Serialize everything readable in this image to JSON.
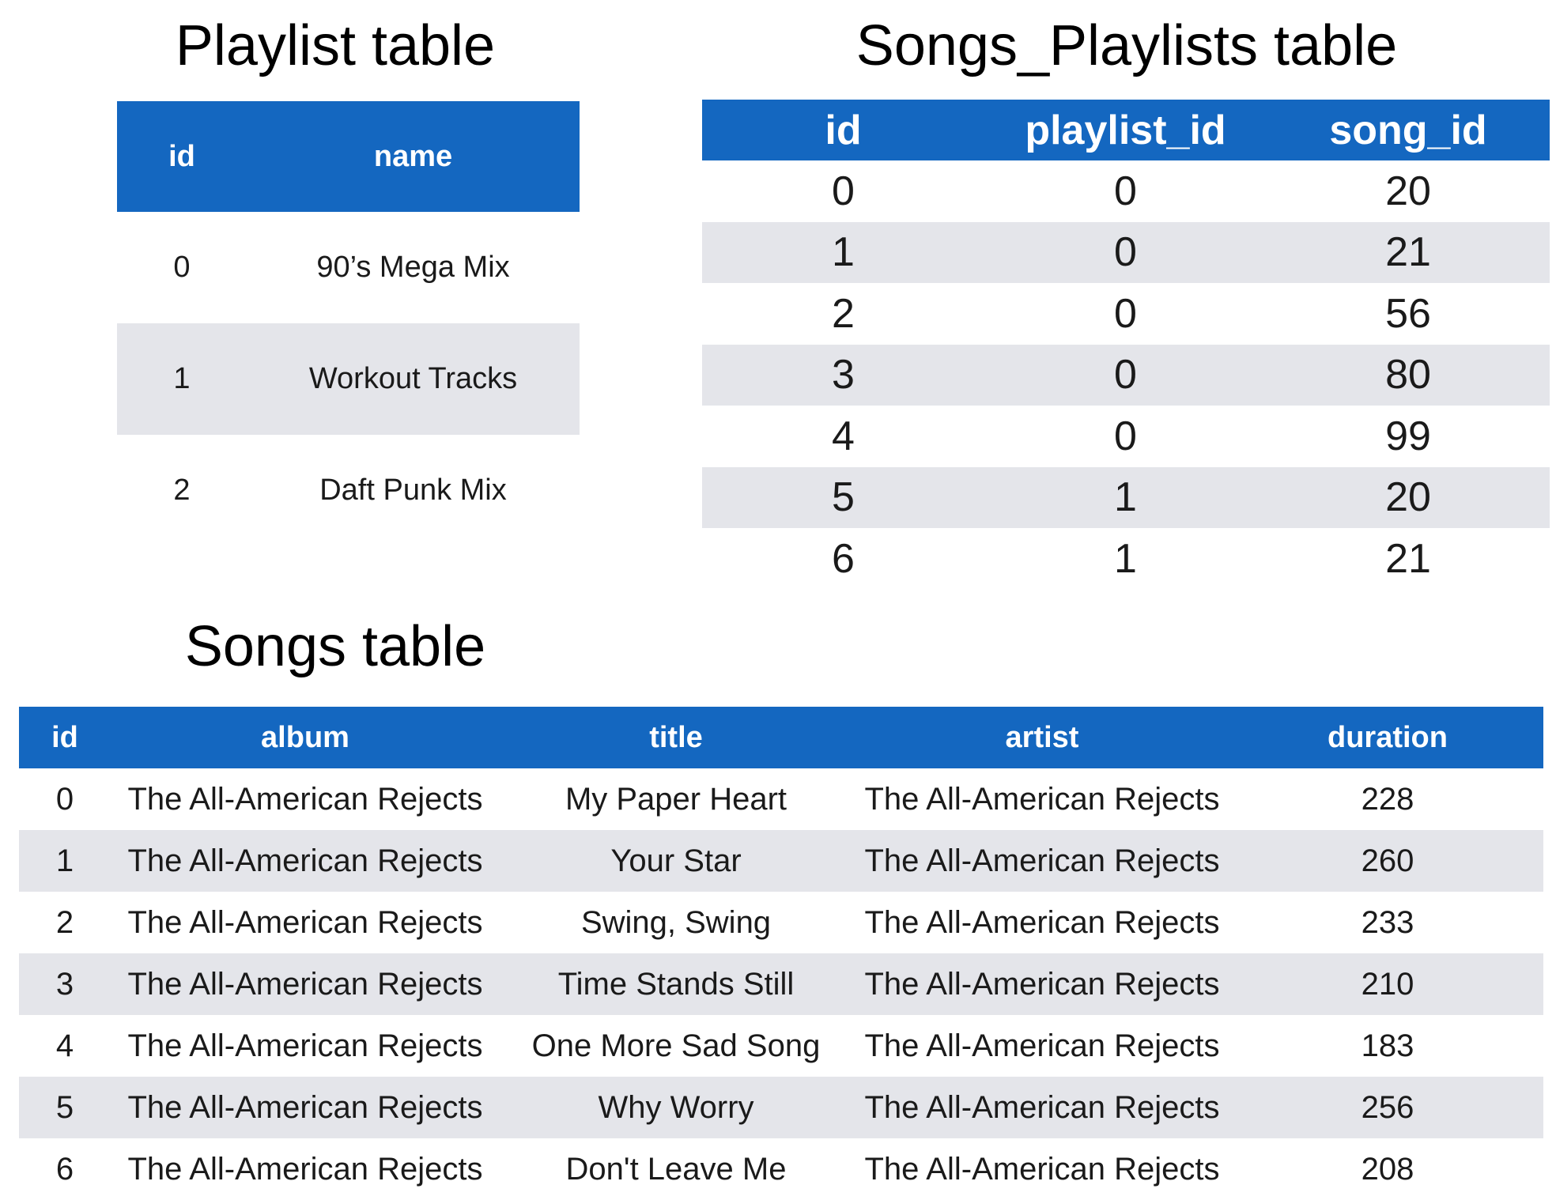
{
  "playlist": {
    "title": "Playlist table",
    "headers": [
      "id",
      "name"
    ],
    "rows": [
      [
        "0",
        "90’s Mega Mix"
      ],
      [
        "1",
        "Workout Tracks"
      ],
      [
        "2",
        "Daft Punk Mix"
      ]
    ]
  },
  "songs_playlists": {
    "title": "Songs_Playlists table",
    "headers": [
      "id",
      "playlist_id",
      "song_id"
    ],
    "rows": [
      [
        "0",
        "0",
        "20"
      ],
      [
        "1",
        "0",
        "21"
      ],
      [
        "2",
        "0",
        "56"
      ],
      [
        "3",
        "0",
        "80"
      ],
      [
        "4",
        "0",
        "99"
      ],
      [
        "5",
        "1",
        "20"
      ],
      [
        "6",
        "1",
        "21"
      ]
    ]
  },
  "songs": {
    "title": "Songs table",
    "headers": [
      "id",
      "album",
      "title",
      "artist",
      "duration"
    ],
    "rows": [
      [
        "0",
        "The All-American Rejects",
        "My Paper Heart",
        "The All-American Rejects",
        "228"
      ],
      [
        "1",
        "The All-American Rejects",
        "Your Star",
        "The All-American Rejects",
        "260"
      ],
      [
        "2",
        "The All-American Rejects",
        "Swing, Swing",
        "The All-American Rejects",
        "233"
      ],
      [
        "3",
        "The All-American Rejects",
        "Time Stands Still",
        "The All-American Rejects",
        "210"
      ],
      [
        "4",
        "The All-American Rejects",
        "One More Sad Song",
        "The All-American Rejects",
        "183"
      ],
      [
        "5",
        "The All-American Rejects",
        "Why Worry",
        "The All-American Rejects",
        "256"
      ],
      [
        "6",
        "The All-American Rejects",
        "Don't Leave Me",
        "The All-American Rejects",
        "208"
      ]
    ]
  },
  "colors": {
    "header_bg": "#1467c0",
    "header_text": "#ffffff",
    "alt_row_bg": "#e4e5ea"
  }
}
